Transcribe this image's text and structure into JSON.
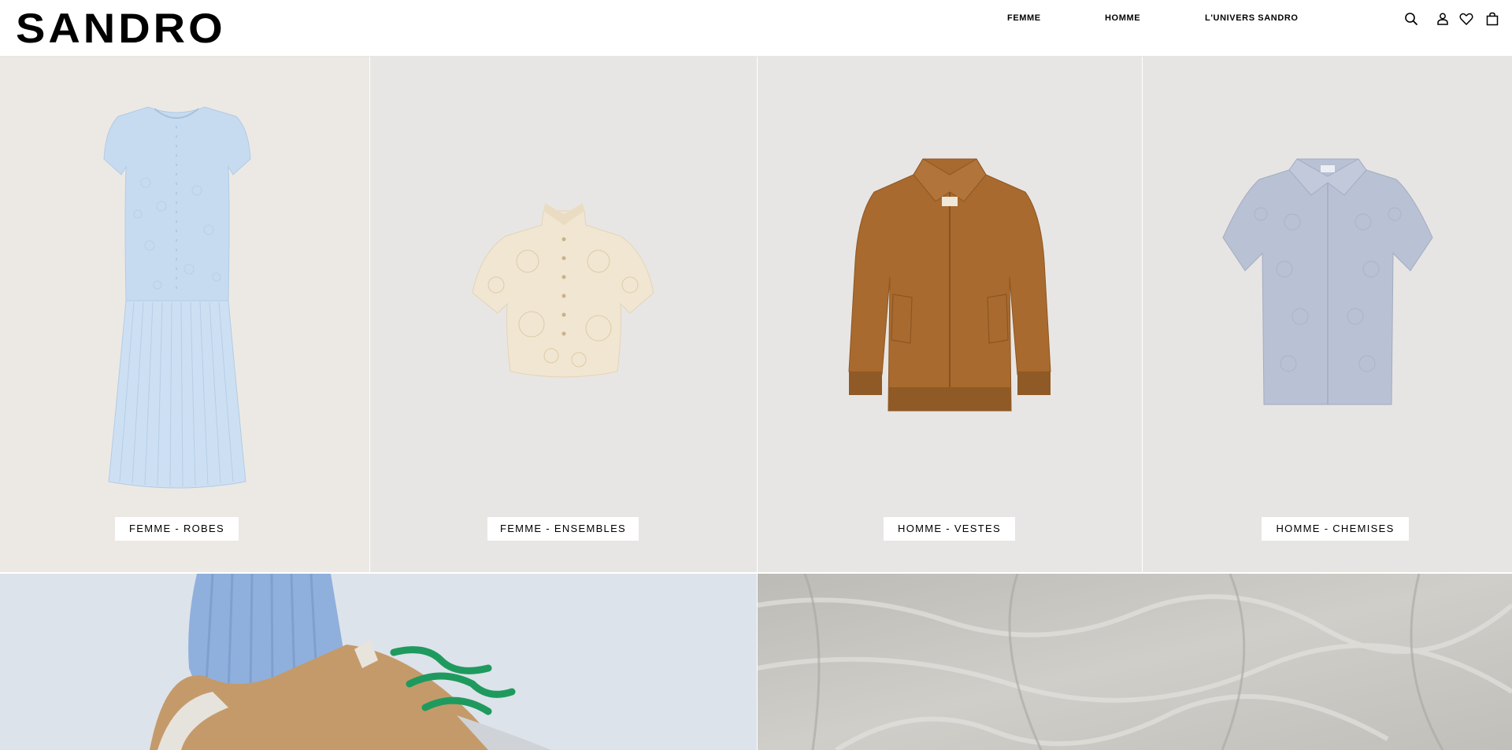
{
  "brand": {
    "logo_text": "SANDRO"
  },
  "nav": {
    "items": [
      {
        "label": "FEMME"
      },
      {
        "label": "HOMME"
      },
      {
        "label": "L'UNIVERS SANDRO"
      }
    ]
  },
  "header_icons": [
    "search-icon",
    "account-icon",
    "wishlist-icon",
    "bag-icon"
  ],
  "tiles": [
    {
      "label": "FEMME - ROBES",
      "product": "light blue knit dress",
      "color": "#c7dcf1"
    },
    {
      "label": "FEMME - ENSEMBLES",
      "product": "cream lace cropped blouse",
      "color": "#f2e7d2"
    },
    {
      "label": "HOMME - VESTES",
      "product": "tan suede bomber jacket",
      "color": "#a9682c"
    },
    {
      "label": "HOMME - CHEMISES",
      "product": "grey-blue jacquard short-sleeve shirt",
      "color": "#b8c0d2"
    }
  ],
  "banners": [
    {
      "subject": "sneaker with green laces and blue sock"
    },
    {
      "subject": "crumpled grey linen fabric"
    }
  ],
  "colors": {
    "header_bg": "#ffffff",
    "tile_bg": "#e8e6e4",
    "label_bg": "#ffffff",
    "text": "#000000"
  }
}
